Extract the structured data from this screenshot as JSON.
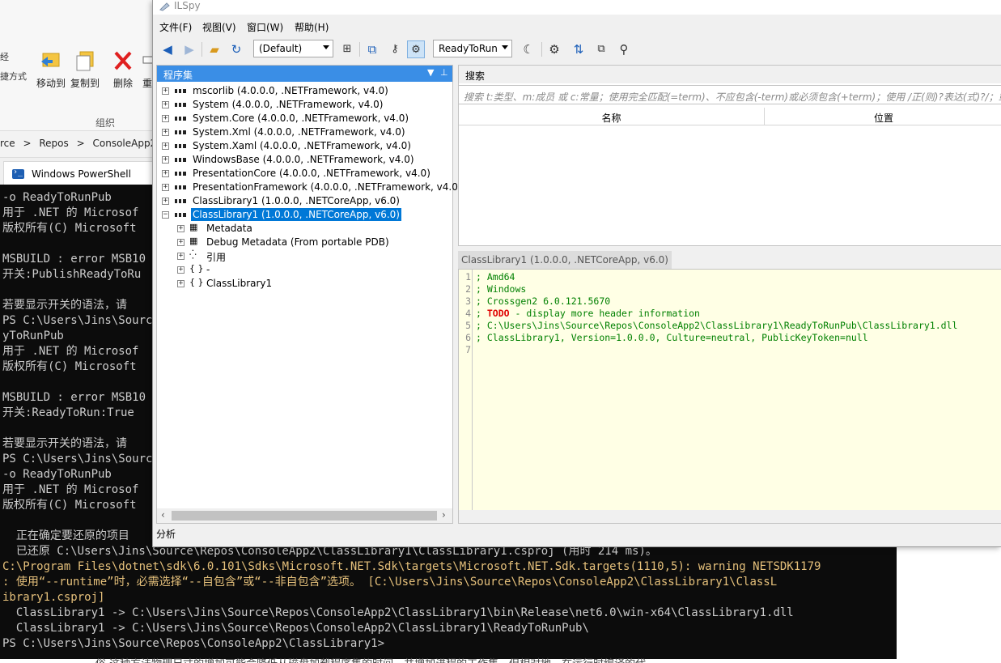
{
  "explorer": {
    "ribbon_cut_left_top": "经",
    "ribbon_cut_left_mid": "捷方式",
    "buttons": [
      {
        "label": "移动到",
        "icon": "move-to-icon"
      },
      {
        "label": "复制到",
        "icon": "copy-to-icon"
      },
      {
        "label": "删除",
        "icon": "delete-icon"
      },
      {
        "label": "重",
        "icon": "rename-icon"
      }
    ],
    "group_label": "组织",
    "breadcrumb": [
      "rce",
      ">",
      "Repos",
      ">",
      "ConsoleApp2"
    ]
  },
  "powershell": {
    "tab_label": "Windows PowerShell",
    "lines": [
      {
        "text": "-o ReadyToRunPub",
        "style": "normal"
      },
      {
        "text": "用于 .NET 的 Microsof",
        "style": "normal"
      },
      {
        "text": "版权所有(C) Microsoft",
        "style": "normal"
      },
      {
        "text": "",
        "style": "normal"
      },
      {
        "text": "MSBUILD : error MSB10",
        "style": "normal"
      },
      {
        "text": "开关:PublishReadyToRu",
        "style": "normal"
      },
      {
        "text": "",
        "style": "normal"
      },
      {
        "text": "若要显示开关的语法，请",
        "style": "normal"
      },
      {
        "text": "PS C:\\Users\\Jins\\Sourc",
        "style": "normal"
      },
      {
        "text": "yToRunPub",
        "style": "normal"
      },
      {
        "text": "用于 .NET 的 Microsof",
        "style": "normal"
      },
      {
        "text": "版权所有(C) Microsoft",
        "style": "normal"
      },
      {
        "text": "",
        "style": "normal"
      },
      {
        "text": "MSBUILD : error MSB10",
        "style": "normal"
      },
      {
        "text": "开关:ReadyToRun:True",
        "style": "normal"
      },
      {
        "text": "",
        "style": "normal"
      },
      {
        "text": "若要显示开关的语法，请",
        "style": "normal"
      },
      {
        "text": "PS C:\\Users\\Jins\\Sourc",
        "style": "normal"
      },
      {
        "text": "-o ReadyToRunPub",
        "style": "normal"
      },
      {
        "text": "用于 .NET 的 Microsof",
        "style": "normal"
      },
      {
        "text": "版权所有(C) Microsoft",
        "style": "normal"
      },
      {
        "text": "",
        "style": "normal"
      },
      {
        "text": "  正在确定要还原的项目",
        "style": "normal"
      },
      {
        "text": "  已还原 C:\\Users\\Jins\\Source\\Repos\\ConsoleApp2\\ClassLibrary1\\ClassLibrary1.csproj (用时 214 ms)。",
        "style": "normal"
      },
      {
        "text": "C:\\Program Files\\dotnet\\sdk\\6.0.101\\Sdks\\Microsoft.NET.Sdk\\targets\\Microsoft.NET.Sdk.targets(1110,5): warning NETSDK1179",
        "style": "warning"
      },
      {
        "text": ": 使用“--runtime”时，必需选择“--自包含”或“--非自包含”选项。 [C:\\Users\\Jins\\Source\\Repos\\ConsoleApp2\\ClassLibrary1\\ClassL",
        "style": "warning"
      },
      {
        "text": "ibrary1.csproj]",
        "style": "warning"
      },
      {
        "text": "  ClassLibrary1 -> C:\\Users\\Jins\\Source\\Repos\\ConsoleApp2\\ClassLibrary1\\bin\\Release\\net6.0\\win-x64\\ClassLibrary1.dll",
        "style": "normal"
      },
      {
        "text": "  ClassLibrary1 -> C:\\Users\\Jins\\Source\\Repos\\ConsoleApp2\\ClassLibrary1\\ReadyToRunPub\\",
        "style": "normal"
      },
      {
        "text": "PS C:\\Users\\Jins\\Source\\Repos\\ConsoleApp2\\ClassLibrary1>",
        "style": "normal"
      }
    ],
    "colors": {
      "background": "#0c0c0c",
      "text": "#cccccc",
      "warning": "#e5c07b"
    }
  },
  "bottom_text": "俗 这种方法物理尺寸的增加可能会降低从磁盘加载程序集的时间，并增加进程的工作集，但相对地，在运行时编译的代",
  "ilspy": {
    "title": "ILSpy",
    "menus": [
      "文件(F)",
      "视图(V)",
      "窗口(W)",
      "帮助(H)"
    ],
    "toolbar": {
      "language_combo": "(Default)",
      "mode_combo": "ReadyToRun"
    },
    "assemblies_pane": {
      "header": "程序集",
      "items": [
        {
          "label": "mscorlib (4.0.0.0, .NETFramework, v4.0)",
          "expander": "+",
          "icon": "assembly-icon",
          "selected": false
        },
        {
          "label": "System (4.0.0.0, .NETFramework, v4.0)",
          "expander": "+",
          "icon": "assembly-icon",
          "selected": false
        },
        {
          "label": "System.Core (4.0.0.0, .NETFramework, v4.0)",
          "expander": "+",
          "icon": "assembly-icon",
          "selected": false
        },
        {
          "label": "System.Xml (4.0.0.0, .NETFramework, v4.0)",
          "expander": "+",
          "icon": "assembly-icon",
          "selected": false
        },
        {
          "label": "System.Xaml (4.0.0.0, .NETFramework, v4.0)",
          "expander": "+",
          "icon": "assembly-icon",
          "selected": false
        },
        {
          "label": "WindowsBase (4.0.0.0, .NETFramework, v4.0)",
          "expander": "+",
          "icon": "assembly-icon",
          "selected": false
        },
        {
          "label": "PresentationCore (4.0.0.0, .NETFramework, v4.0)",
          "expander": "+",
          "icon": "assembly-icon",
          "selected": false
        },
        {
          "label": "PresentationFramework (4.0.0.0, .NETFramework, v4.0)",
          "expander": "+",
          "icon": "assembly-icon",
          "selected": false
        },
        {
          "label": "ClassLibrary1 (1.0.0.0, .NETCoreApp, v6.0)",
          "expander": "+",
          "icon": "assembly-icon",
          "selected": false
        },
        {
          "label": "ClassLibrary1 (1.0.0.0, .NETCoreApp, v6.0)",
          "expander": "−",
          "icon": "assembly-icon",
          "selected": true
        }
      ],
      "children": [
        {
          "label": "Metadata",
          "icon": "metadata-table-icon"
        },
        {
          "label": "Debug Metadata (From portable PDB)",
          "icon": "metadata-table-icon"
        },
        {
          "label": "引用",
          "icon": "references-icon"
        },
        {
          "label": "-",
          "icon": "namespace-icon"
        },
        {
          "label": "ClassLibrary1",
          "icon": "namespace-icon"
        }
      ]
    },
    "search_pane": {
      "label": "搜索",
      "placeholder": "搜索 t:类型、m:成员 或 c:常量；使用完全匹配(=term)、不应包含(-term)或必须包含(+term)；使用 /正(则)?表达(式)?/；或同",
      "columns": [
        "名称",
        "位置"
      ]
    },
    "code_tab": "ClassLibrary1 (1.0.0.0, .NETCoreApp, v6.0)",
    "code_lines": [
      {
        "n": "1",
        "text": "; Amd64",
        "todo": ""
      },
      {
        "n": "2",
        "text": "; Windows",
        "todo": ""
      },
      {
        "n": "3",
        "text": "; Crossgen2 6.0.121.5670",
        "todo": ""
      },
      {
        "n": "4",
        "text": " - display more header information",
        "todo": "TODO",
        "prefix": "; "
      },
      {
        "n": "5",
        "text": "; C:\\Users\\Jins\\Source\\Repos\\ConsoleApp2\\ClassLibrary1\\ReadyToRunPub\\ClassLibrary1.dll",
        "todo": ""
      },
      {
        "n": "6",
        "text": "; ClassLibrary1, Version=1.0.0.0, Culture=neutral, PublicKeyToken=null",
        "todo": ""
      },
      {
        "n": "7",
        "text": "",
        "todo": ""
      }
    ],
    "analyzer_label": "分析",
    "colors": {
      "selection": "#0078d7",
      "pane_header": "#3a8ee6",
      "code_background": "#ffffe5",
      "comment": "#008000",
      "todo": "#e00000"
    }
  }
}
